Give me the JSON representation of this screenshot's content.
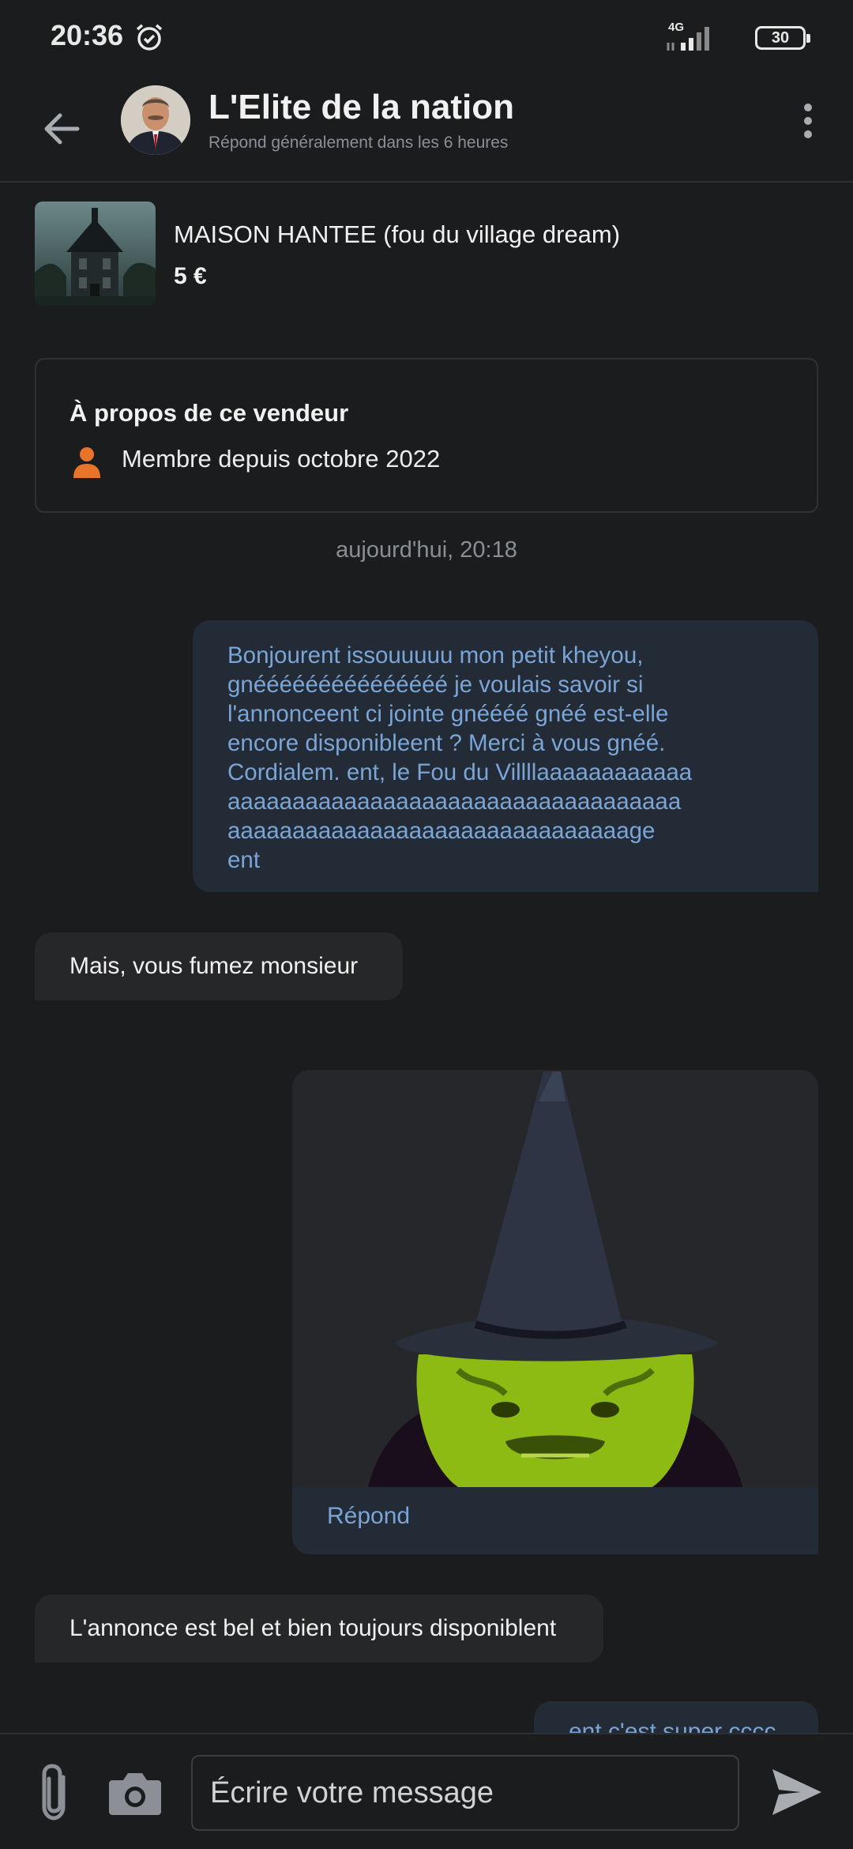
{
  "status_bar": {
    "time": "20:36",
    "network": "4G",
    "battery": "30"
  },
  "header": {
    "title": "L'Elite de la nation",
    "subtitle": "Répond généralement dans les 6 heures"
  },
  "listing": {
    "title": "MAISON HANTEE (fou du village dream)",
    "price": "5 €"
  },
  "seller": {
    "title": "À propos de ce vendeur",
    "member_since": "Membre depuis octobre 2022"
  },
  "conversation": {
    "timestamp": "aujourd'hui, 20:18",
    "messages": [
      {
        "direction": "outgoing",
        "lines": [
          "Bonjourent issouuuuu mon petit kheyou,",
          "gnééééééééééééééé je voulais savoir si",
          "l'annonceent ci jointe gnéééé gnéé est-elle",
          "encore disponibleent ? Merci à vous gnéé.",
          "Cordialem. ent, le Fou du Villllaaaaaaaaaaaa",
          "aaaaaaaaaaaaaaaaaaaaaaaaaaaaaaaaaaa",
          "aaaaaaaaaaaaaaaaaaaaaaaaaaaaaaage",
          "ent"
        ]
      },
      {
        "direction": "incoming",
        "text": "Mais, vous fumez monsieur"
      },
      {
        "direction": "outgoing",
        "type": "image",
        "caption": "Répond"
      },
      {
        "direction": "incoming",
        "text": "L'annonce est bel et bien toujours disponiblent"
      },
      {
        "direction": "outgoing",
        "text": "ent c'est super cccc"
      }
    ]
  },
  "composer": {
    "placeholder": "Écrire votre message"
  },
  "icons": {
    "back": "arrow-left-icon",
    "more": "more-vertical-icon",
    "person": "person-icon",
    "attach": "paperclip-icon",
    "camera": "camera-icon",
    "send": "send-icon",
    "alarm": "alarm-icon"
  },
  "colors": {
    "background": "#1b1c1d",
    "outgoing_bubble": "#232b36",
    "outgoing_text": "#7aa5d6",
    "incoming_bubble": "#262729",
    "accent_orange": "#e8742a"
  }
}
